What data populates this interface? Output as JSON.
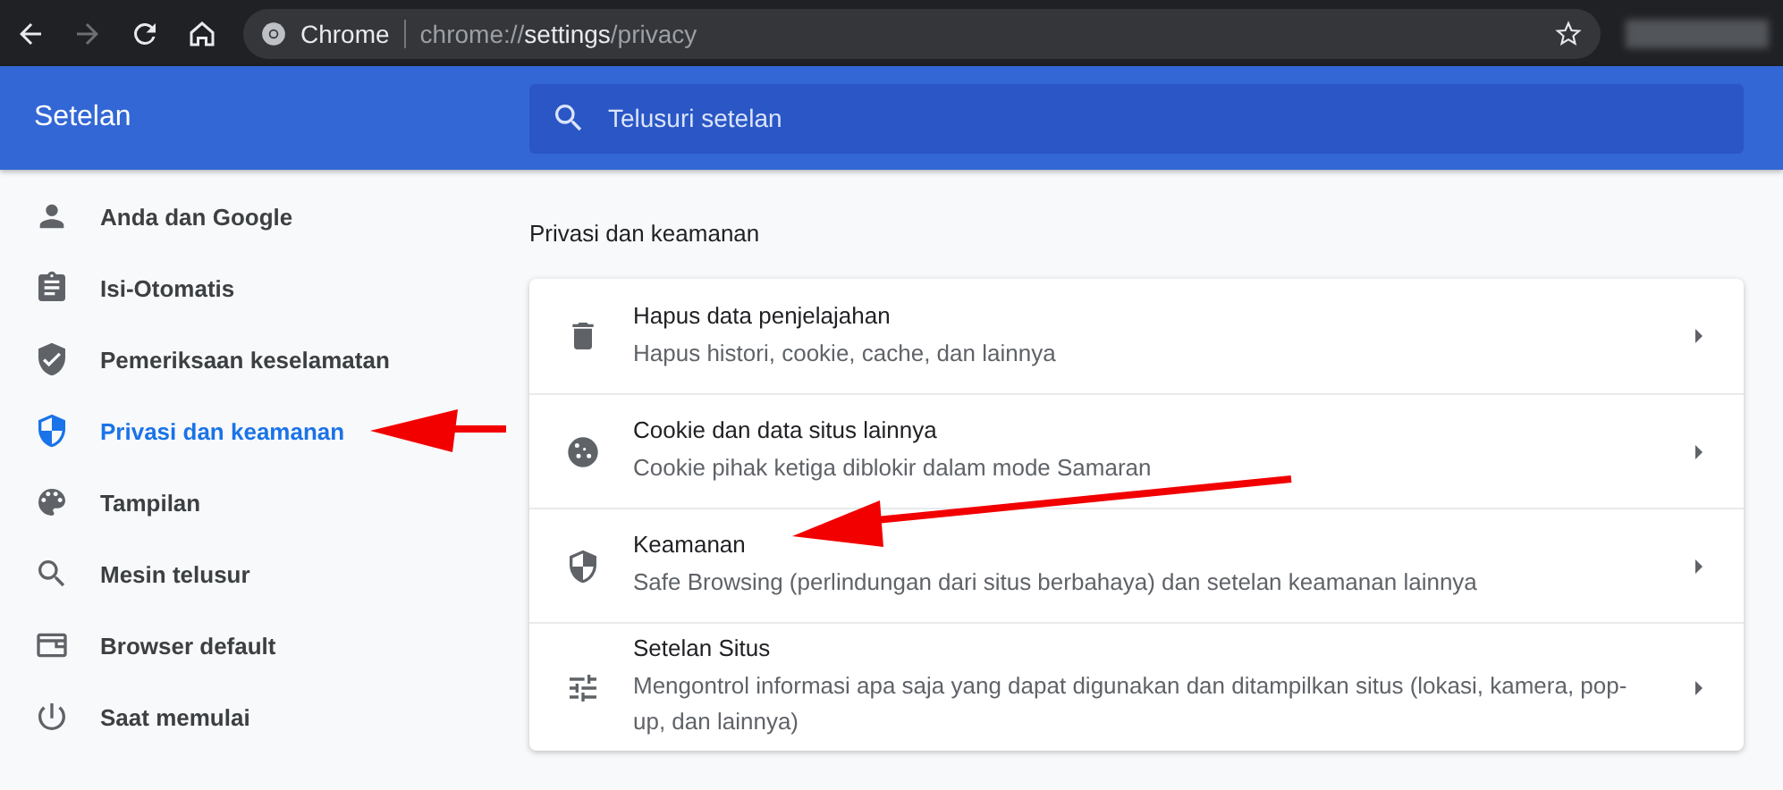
{
  "toolbar": {
    "forward_disabled": true,
    "site_label": "Chrome",
    "url": "chrome://**settings**/privacy"
  },
  "header": {
    "title": "Setelan",
    "search": {
      "placeholder": "Telusuri setelan"
    }
  },
  "sidebar": {
    "items": [
      {
        "label": "Anda dan Google",
        "selected": false
      },
      {
        "label": "Isi-Otomatis",
        "selected": false
      },
      {
        "label": "Pemeriksaan keselamatan",
        "selected": false
      },
      {
        "label": "Privasi dan keamanan",
        "selected": true
      },
      {
        "label": "Tampilan",
        "selected": false
      },
      {
        "label": "Mesin telusur",
        "selected": false
      },
      {
        "label": "Browser default",
        "selected": false
      },
      {
        "label": "Saat memulai",
        "selected": false
      }
    ]
  },
  "section": {
    "title": "Privasi dan keamanan",
    "rows": [
      {
        "title": "Hapus data penjelajahan",
        "subtitle": "Hapus histori, cookie, cache, dan lainnya"
      },
      {
        "title": "Cookie dan data situs lainnya",
        "subtitle": "Cookie pihak ketiga diblokir dalam mode Samaran"
      },
      {
        "title": "Keamanan",
        "subtitle": "Safe Browsing (perlindungan dari situs berbahaya) dan setelan keamanan lainnya"
      },
      {
        "title": "Setelan Situs",
        "subtitle": "Mengontrol informasi apa saja yang dapat digunakan dan ditampilkan situs (lokasi, kamera, pop-up, dan lainnya)"
      }
    ]
  }
}
